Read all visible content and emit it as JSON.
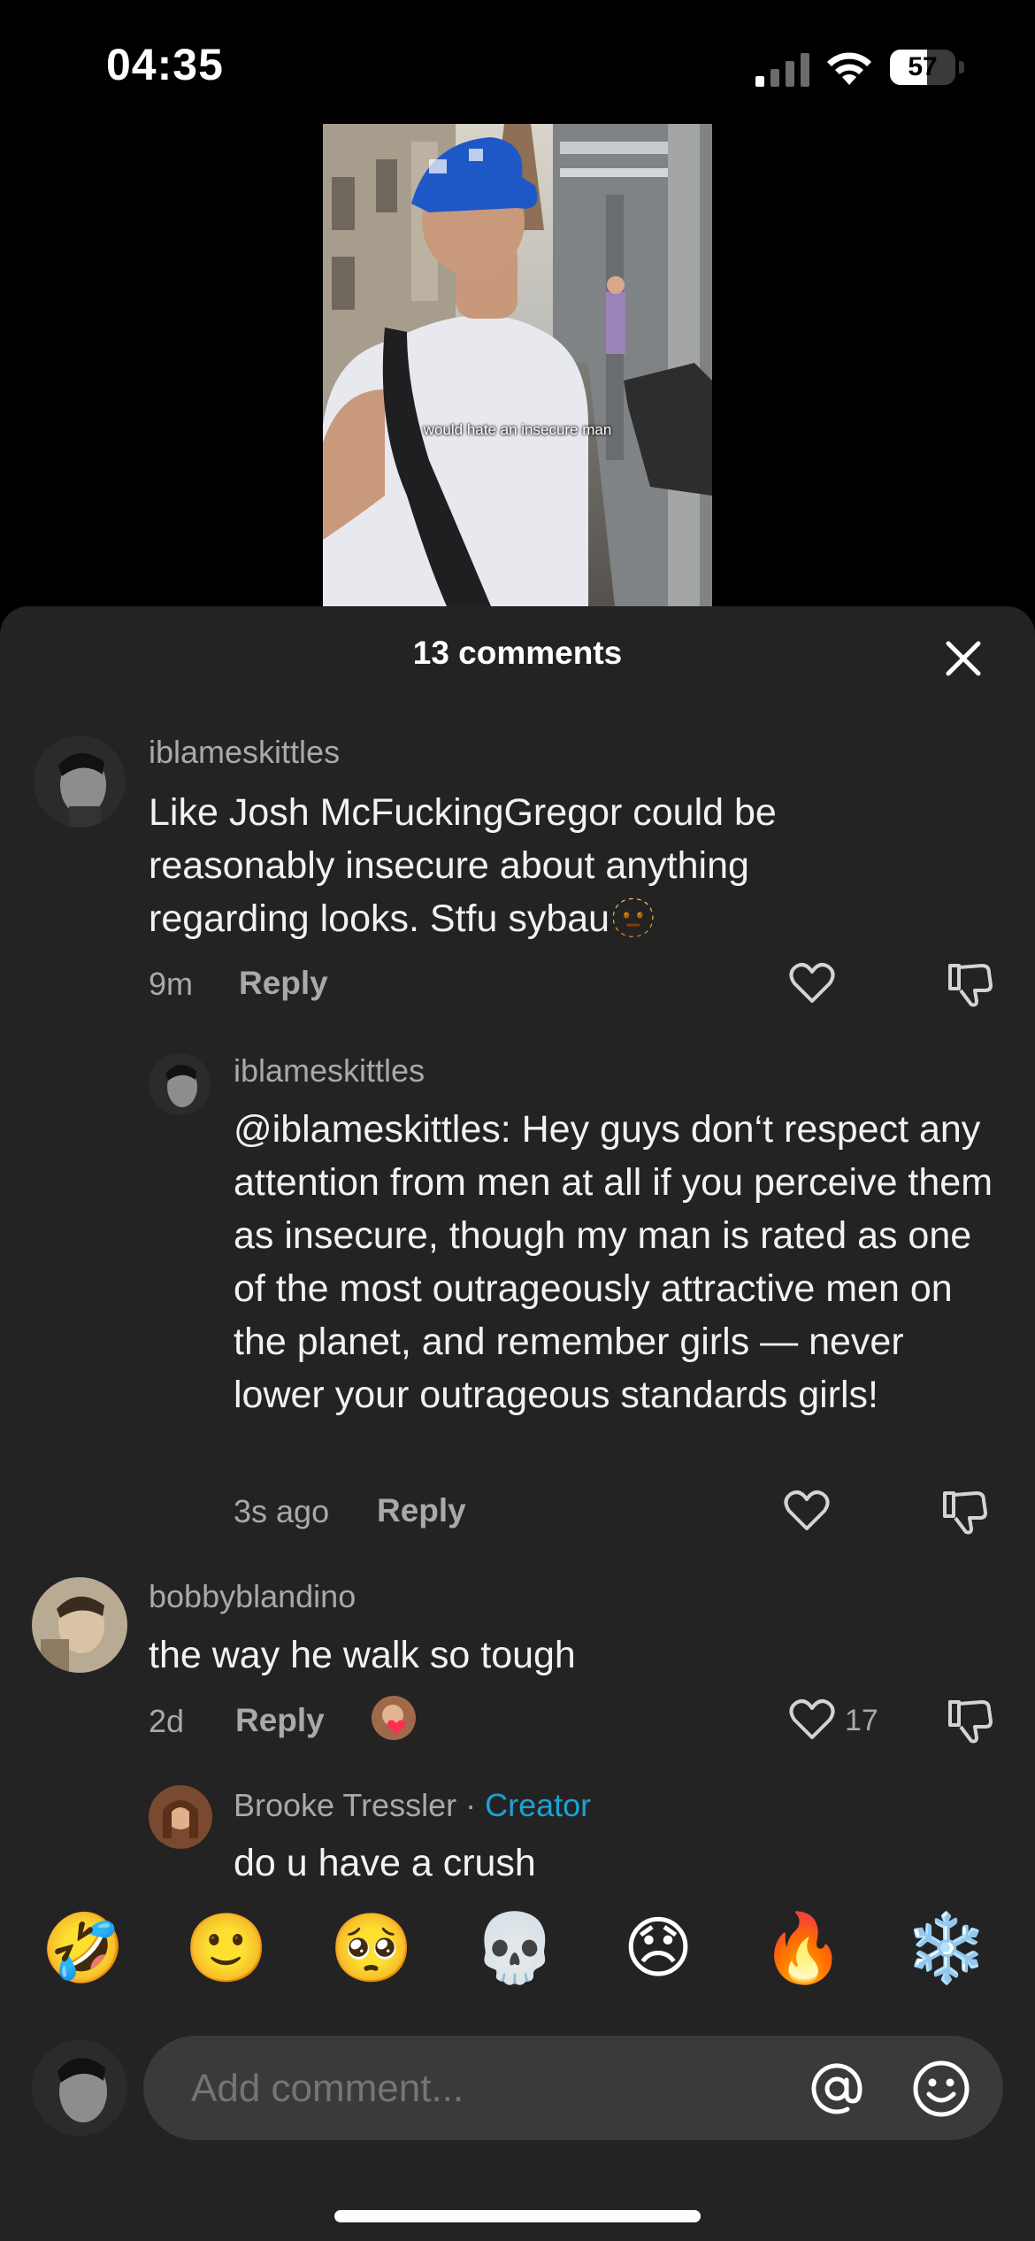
{
  "status_bar": {
    "time": "04:35",
    "battery_level": "57",
    "battery_fraction": 0.57
  },
  "video": {
    "caption": "would hate an insecure man"
  },
  "sheet": {
    "title": "13 comments",
    "close_icon": "close-icon"
  },
  "comments": [
    {
      "username": "iblameskittles",
      "text": "Like Josh McFuckingGregor could be reasonably insecure about anything regarding looks. Stfu sybau",
      "emoji": "🫥",
      "age": "9m",
      "reply_label": "Reply"
    },
    {
      "username": "iblameskittles",
      "text": "@iblameskittles: Hey guys don‘t respect any attention from men at all if you perceive them as insecure, though my man is rated as one of the most outrageously attractive men on the planet, and remember girls — never lower your outrageous standards girls!",
      "age": "3s ago",
      "reply_label": "Reply"
    },
    {
      "username": "bobbyblandino",
      "text": "the way he walk so tough",
      "age": "2d",
      "reply_label": "Reply",
      "like_count": "17"
    },
    {
      "username": "Brooke Tressler",
      "separator": " · ",
      "badge": "Creator",
      "text": "do u have a crush"
    }
  ],
  "emoji_bar": [
    "🤣",
    "🙂",
    "🥺",
    "💀",
    "😞",
    "🔥",
    "❄️"
  ],
  "input": {
    "placeholder": "Add comment..."
  },
  "colors": {
    "sheet_bg": "#232323",
    "creator_accent": "#1aa3d4",
    "input_bg": "#3a3a3a"
  }
}
